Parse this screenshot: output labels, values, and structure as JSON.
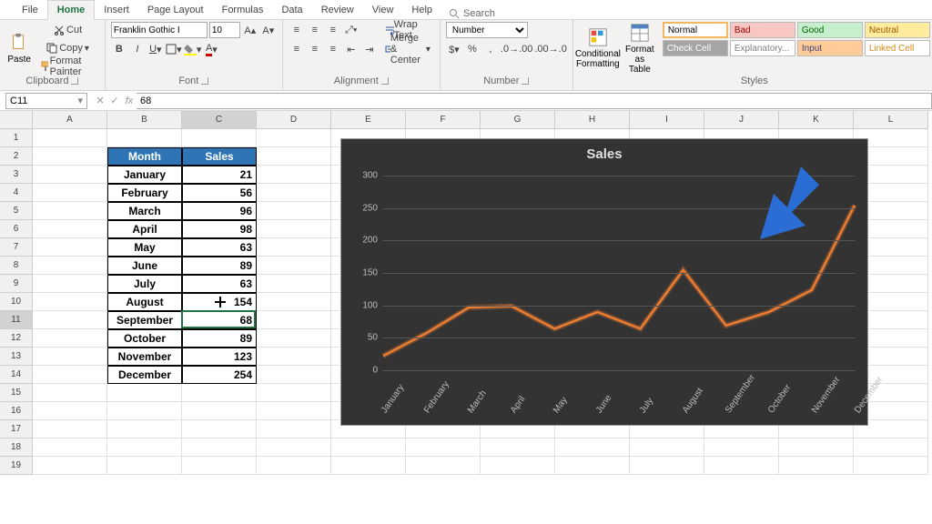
{
  "tabs": [
    "File",
    "Home",
    "Insert",
    "Page Layout",
    "Formulas",
    "Data",
    "Review",
    "View",
    "Help"
  ],
  "active_tab": "Home",
  "search_placeholder": "Search",
  "clipboard": {
    "paste": "Paste",
    "cut": "Cut",
    "copy": "Copy",
    "painter": "Format Painter",
    "label": "Clipboard"
  },
  "font": {
    "name": "Franklin Gothic I",
    "size": "10",
    "label": "Font"
  },
  "alignment": {
    "wrap": "Wrap Text",
    "merge": "Merge & Center",
    "label": "Alignment"
  },
  "number": {
    "format": "Number",
    "label": "Number"
  },
  "cond": {
    "formatting": "Conditional\nFormatting",
    "table": "Format as\nTable"
  },
  "styles": {
    "label": "Styles",
    "cells": [
      {
        "t": "Normal",
        "bg": "#fff",
        "c": "#000"
      },
      {
        "t": "Bad",
        "bg": "#f8c7c4",
        "c": "#9c0006"
      },
      {
        "t": "Good",
        "bg": "#c6efce",
        "c": "#006100"
      },
      {
        "t": "Neutral",
        "bg": "#ffeb9c",
        "c": "#9c5700"
      },
      {
        "t": "Check Cell",
        "bg": "#a5a5a5",
        "c": "#fff"
      },
      {
        "t": "Explanatory...",
        "bg": "#fff",
        "c": "#7f7f7f"
      },
      {
        "t": "Input",
        "bg": "#ffcc99",
        "c": "#3f3f76"
      },
      {
        "t": "Linked Cell",
        "bg": "#fff",
        "c": "#d68a17"
      }
    ]
  },
  "namebox": "C11",
  "formula": "68",
  "columns": [
    "A",
    "B",
    "C",
    "D",
    "E",
    "F",
    "G",
    "H",
    "I",
    "J",
    "K",
    "L"
  ],
  "table": {
    "headers": [
      "Month",
      "Sales"
    ],
    "rows": [
      [
        "January",
        "21"
      ],
      [
        "February",
        "56"
      ],
      [
        "March",
        "96"
      ],
      [
        "April",
        "98"
      ],
      [
        "May",
        "63"
      ],
      [
        "June",
        "89"
      ],
      [
        "July",
        "63"
      ],
      [
        "August",
        "154"
      ],
      [
        "September",
        "68"
      ],
      [
        "October",
        "89"
      ],
      [
        "November",
        "123"
      ],
      [
        "December",
        "254"
      ]
    ]
  },
  "chart_data": {
    "type": "line",
    "title": "Sales",
    "categories": [
      "January",
      "February",
      "March",
      "April",
      "May",
      "June",
      "July",
      "August",
      "September",
      "October",
      "November",
      "December"
    ],
    "values": [
      21,
      56,
      96,
      98,
      63,
      89,
      63,
      154,
      68,
      89,
      123,
      254
    ],
    "ylim": [
      0,
      300
    ],
    "ytick": 50,
    "series_name": "Sales",
    "line_color": "#ed7d31"
  }
}
